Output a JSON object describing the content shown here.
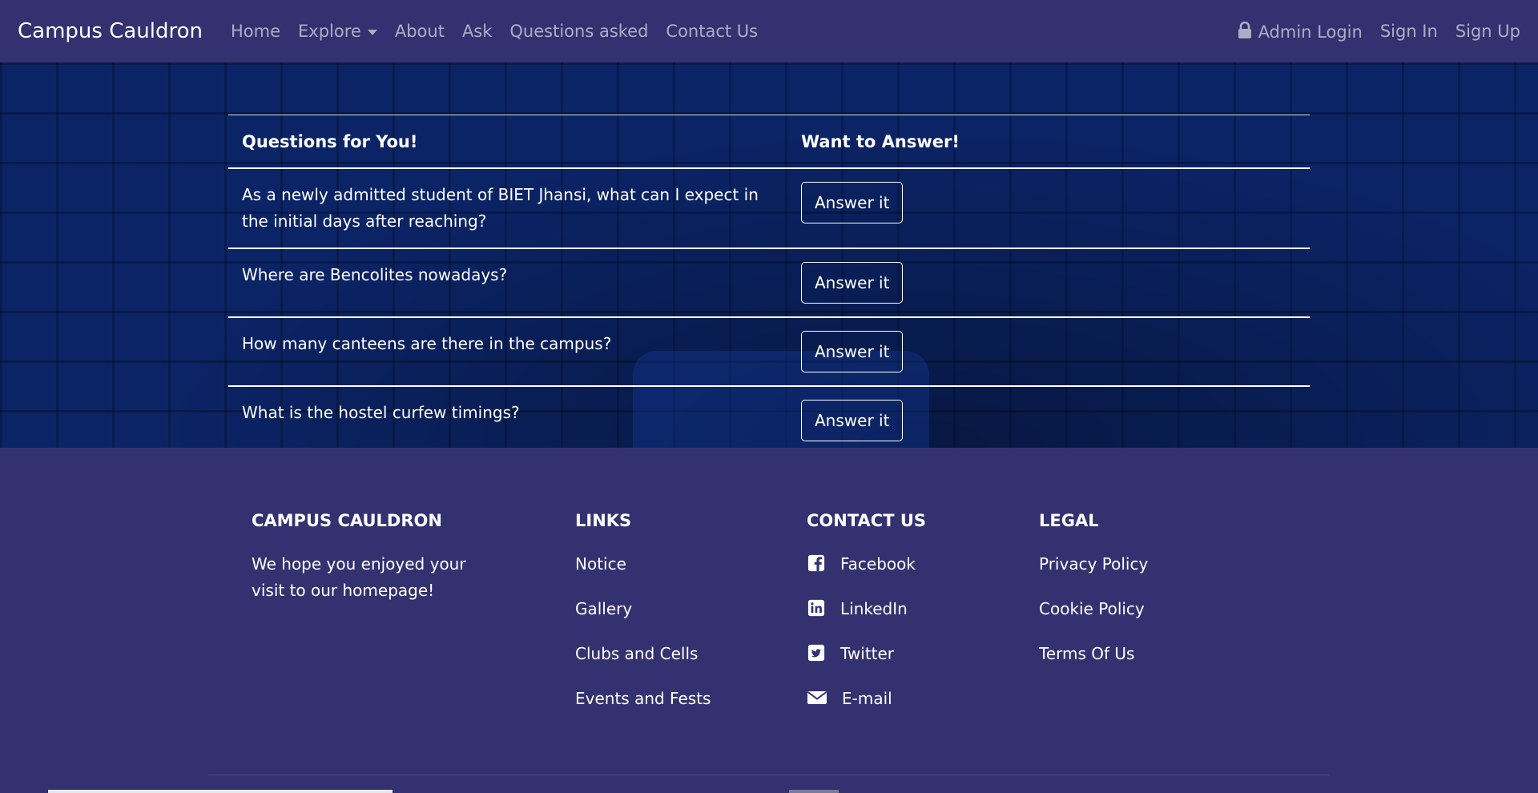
{
  "navbar": {
    "brand": "Campus Cauldron",
    "links": [
      "Home",
      "Explore",
      "About",
      "Ask",
      "Questions asked",
      "Contact Us"
    ],
    "right_links": {
      "admin": "Admin Login",
      "sign_in": "Sign In",
      "sign_up": "Sign Up"
    }
  },
  "questions_table": {
    "headers": [
      "Questions for You!",
      "Want to Answer!"
    ],
    "rows": [
      {
        "question": "As a newly admitted student of BIET Jhansi, what can I expect in the initial days after reaching?",
        "action": "Answer it"
      },
      {
        "question": "Where are Bencolites nowadays?",
        "action": "Answer it"
      },
      {
        "question": "How many canteens are there in the campus?",
        "action": "Answer it"
      },
      {
        "question": "What is the hostel curfew timings?",
        "action": "Answer it"
      }
    ]
  },
  "footer": {
    "about": {
      "heading": "CAMPUS CAULDRON",
      "text": "We hope you enjoyed your visit to our homepage!"
    },
    "links": {
      "heading": "LINKS",
      "items": [
        "Notice",
        "Gallery",
        "Clubs and Cells",
        "Events and Fests"
      ]
    },
    "contact": {
      "heading": "CONTACT US",
      "items": [
        {
          "label": "Facebook",
          "icon": "facebook-icon"
        },
        {
          "label": "LinkedIn",
          "icon": "linkedin-icon"
        },
        {
          "label": "Twitter",
          "icon": "twitter-icon"
        },
        {
          "label": "E-mail",
          "icon": "envelope-icon"
        }
      ]
    },
    "legal": {
      "heading": "LEGAL",
      "items": [
        "Privacy Policy",
        "Cookie Policy",
        "Terms Of Us"
      ]
    }
  },
  "colors": {
    "navbar_bg": "#343170",
    "footer_bg": "#343170",
    "hero_bg": "#0b2466",
    "nav_link": "rgba(255,255,255,0.6)"
  }
}
